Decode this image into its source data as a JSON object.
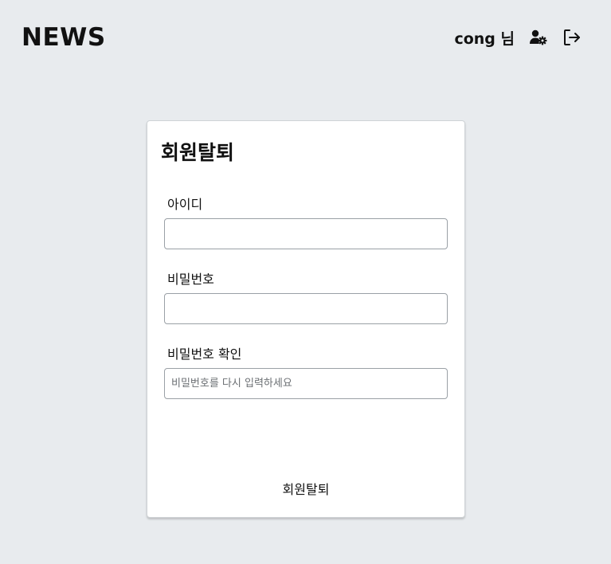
{
  "header": {
    "logo": "NEWS",
    "user_label": "cong 님",
    "icons": {
      "user_settings": "user-gear-icon",
      "logout": "logout-icon"
    }
  },
  "card": {
    "title": "회원탈퇴",
    "fields": {
      "id": {
        "label": "아이디",
        "value": "",
        "placeholder": ""
      },
      "password": {
        "label": "비밀번호",
        "value": "",
        "placeholder": ""
      },
      "password_confirm": {
        "label": "비밀번호 확인",
        "value": "",
        "placeholder": "비밀번호를 다시 입력하세요"
      }
    },
    "submit_label": "회원탈퇴"
  }
}
